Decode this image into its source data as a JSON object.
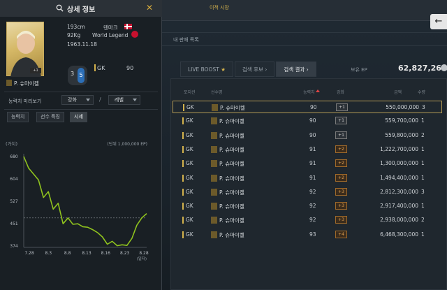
{
  "market": {
    "top_tab": "이적 시장",
    "subtitle": "내 판매 목록",
    "back_icon": "back-arrow-icon",
    "tabs": [
      {
        "label": "LIVE BOOST",
        "icon": "star-icon"
      },
      {
        "label": "검색 후보",
        "icon": "chevron-right-icon"
      },
      {
        "label": "검색 결과",
        "icon": "chevron-right-icon"
      }
    ],
    "ep_label": "보유 EP",
    "ep_value": "62,827,266",
    "columns": [
      "포지션",
      "선수명",
      "능력치",
      "강화",
      "금액",
      "수량"
    ],
    "rows": [
      {
        "pos": "GK",
        "name": "P. 슈마이켈",
        "ovr": "90",
        "boost": "+1",
        "boost_color": "gray",
        "price": "550,000,000",
        "qty": "3",
        "selected": true
      },
      {
        "pos": "GK",
        "name": "P. 슈마이켈",
        "ovr": "90",
        "boost": "+1",
        "boost_color": "gray",
        "price": "559,700,000",
        "qty": "1",
        "selected": false
      },
      {
        "pos": "GK",
        "name": "P. 슈마이켈",
        "ovr": "90",
        "boost": "+1",
        "boost_color": "gray",
        "price": "559,800,000",
        "qty": "2",
        "selected": false
      },
      {
        "pos": "GK",
        "name": "P. 슈마이켈",
        "ovr": "91",
        "boost": "+2",
        "boost_color": "orange",
        "price": "1,222,700,000",
        "qty": "1",
        "selected": false
      },
      {
        "pos": "GK",
        "name": "P. 슈마이켈",
        "ovr": "91",
        "boost": "+2",
        "boost_color": "orange",
        "price": "1,300,000,000",
        "qty": "1",
        "selected": false
      },
      {
        "pos": "GK",
        "name": "P. 슈마이켈",
        "ovr": "91",
        "boost": "+2",
        "boost_color": "orange",
        "price": "1,494,400,000",
        "qty": "1",
        "selected": false
      },
      {
        "pos": "GK",
        "name": "P. 슈마이켈",
        "ovr": "92",
        "boost": "+3",
        "boost_color": "orange",
        "price": "2,812,300,000",
        "qty": "3",
        "selected": false
      },
      {
        "pos": "GK",
        "name": "P. 슈마이켈",
        "ovr": "92",
        "boost": "+3",
        "boost_color": "orange",
        "price": "2,917,400,000",
        "qty": "1",
        "selected": false
      },
      {
        "pos": "GK",
        "name": "P. 슈마이켈",
        "ovr": "92",
        "boost": "+3",
        "boost_color": "orange",
        "price": "2,938,000,000",
        "qty": "2",
        "selected": false
      },
      {
        "pos": "GK",
        "name": "P. 슈마이켈",
        "ovr": "93",
        "boost": "+4",
        "boost_color": "orange",
        "price": "6,468,300,000",
        "qty": "1",
        "selected": false
      }
    ]
  },
  "detail": {
    "title": "상세 정보",
    "search_icon": "search-icon",
    "close_icon": "close-icon",
    "height": "193cm",
    "weight": "92Kg",
    "birth": "1963.11.18",
    "nation": "덴마크",
    "season": "World Legend",
    "card_ovr": "+1",
    "level_a": "3",
    "level_b": "5",
    "position": "GK",
    "position_value": "90",
    "player_name": "P. 슈마이켈",
    "boost_preview_label": "능력치 미리보기",
    "boost_select": "강화",
    "level_select": "레벨",
    "subtabs": [
      "능력치",
      "선수 특징",
      "시세"
    ],
    "active_subtab": 2
  },
  "chart_data": {
    "type": "line",
    "ylabel": "(가치)",
    "unit_label": "(단위 1,000,000 EP)",
    "xlabel": "(일자)",
    "x_ticks": [
      "7.28",
      "8.3",
      "8.8",
      "8.13",
      "8.16",
      "8.23",
      "8.28"
    ],
    "y_ticks": [
      680,
      604,
      527,
      451,
      374
    ],
    "ylim": [
      374,
      680
    ],
    "reference_line": 470,
    "line_color": "#8fc21e",
    "points": [
      680,
      640,
      620,
      600,
      540,
      560,
      500,
      520,
      450,
      470,
      448,
      450,
      440,
      438,
      430,
      420,
      405,
      380,
      390,
      375,
      378,
      376,
      400,
      445,
      470,
      485
    ]
  }
}
